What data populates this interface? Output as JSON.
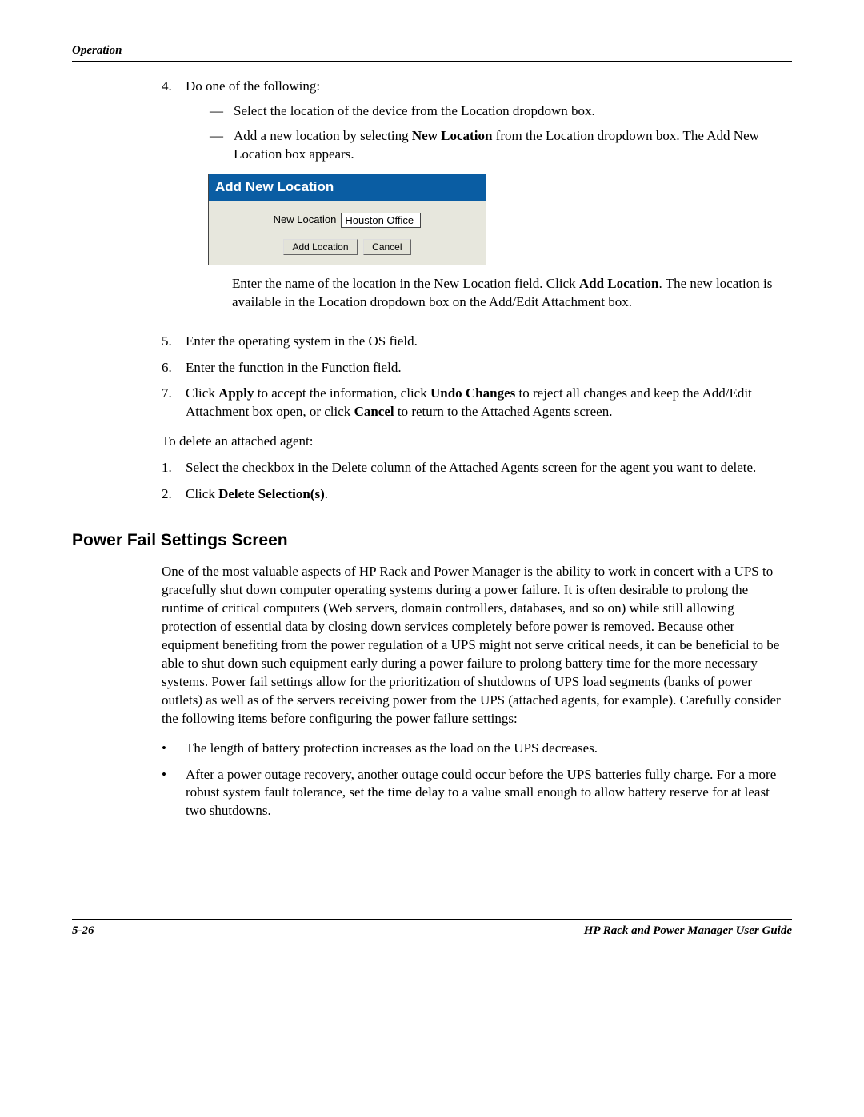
{
  "header": {
    "section": "Operation"
  },
  "step4": {
    "num": "4.",
    "text": "Do one of the following:",
    "dash1": "Select the location of the device from the Location dropdown box.",
    "dash2_pre": "Add a new location by selecting ",
    "dash2_bold": "New Location",
    "dash2_post": " from the Location dropdown box. The Add New Location box appears."
  },
  "dialog": {
    "title": "Add New Location",
    "field_label": "New Location",
    "field_value": "Houston Office",
    "btn_add": "Add Location",
    "btn_cancel": "Cancel"
  },
  "after_dialog": {
    "pre": "Enter the name of the location in the New Location field. Click ",
    "bold": "Add Location",
    "post": ". The new location is available in the Location dropdown box on the Add/Edit Attachment box."
  },
  "step5": {
    "num": "5.",
    "text": "Enter the operating system in the OS field."
  },
  "step6": {
    "num": "6.",
    "text": "Enter the function in the Function field."
  },
  "step7": {
    "num": "7.",
    "pre": "Click ",
    "b1": "Apply",
    "mid1": " to accept the information, click ",
    "b2": "Undo Changes",
    "mid2": " to reject all changes and keep the Add/Edit Attachment box open, or click ",
    "b3": "Cancel",
    "post": " to return to the Attached Agents screen."
  },
  "delete_intro": "To delete an attached agent:",
  "dstep1": {
    "num": "1.",
    "text": "Select the checkbox in the Delete column of the Attached Agents screen for the agent you want to delete."
  },
  "dstep2": {
    "num": "2.",
    "pre": "Click ",
    "bold": "Delete Selection(s)",
    "post": "."
  },
  "heading": "Power Fail Settings Screen",
  "pf_para": "One of the most valuable aspects of HP Rack and Power Manager is the ability to work in concert with a UPS to gracefully shut down computer operating systems during a power failure. It is often desirable to prolong the runtime of critical computers (Web servers, domain controllers, databases, and so on) while still allowing protection of essential data by closing down services completely before power is removed. Because other equipment benefiting from the power regulation of a UPS might not serve critical needs, it can be beneficial to be able to shut down such equipment early during a power failure to prolong battery time for the more necessary systems. Power fail settings allow for the prioritization of shutdowns of UPS load segments (banks of power outlets) as well as of the servers receiving power from the UPS (attached agents, for example). Carefully consider the following items before configuring the power failure settings:",
  "bullet1": "The length of battery protection increases as the load on the UPS decreases.",
  "bullet2": "After a power outage recovery, another outage could occur before the UPS batteries fully charge. For a more robust system fault tolerance, set the time delay to a value small enough to allow battery reserve for at least two shutdowns.",
  "footer": {
    "page": "5-26",
    "title": "HP Rack and Power Manager User Guide"
  }
}
